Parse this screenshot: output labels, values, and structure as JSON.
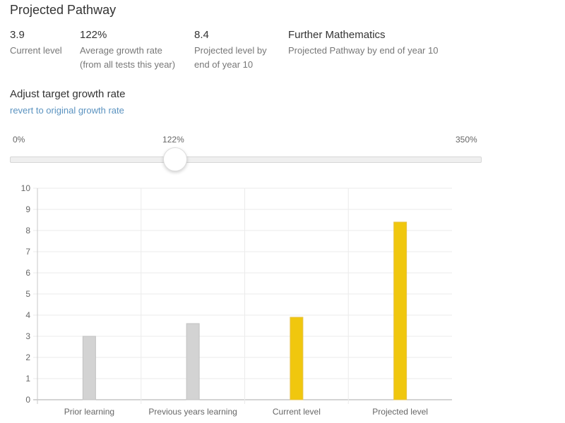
{
  "header": {
    "title": "Projected Pathway"
  },
  "stats": [
    {
      "value": "3.9",
      "label_lines": [
        "Current level"
      ]
    },
    {
      "value": "122%",
      "label_lines": [
        "Average growth rate",
        "(from all tests this year)"
      ]
    },
    {
      "value": "8.4",
      "label_lines": [
        "Projected level by",
        "end of year 10"
      ]
    },
    {
      "value": "Further Mathematics",
      "label_lines": [
        "Projected Pathway by end of year 10"
      ]
    }
  ],
  "adjust": {
    "heading": "Adjust target growth rate",
    "revert_link": "revert to original growth rate"
  },
  "slider": {
    "min_label": "0%",
    "max_label": "350%",
    "value_label": "122%",
    "min": 0,
    "max": 350,
    "value": 122
  },
  "colors": {
    "past_bar": "#d3d3d3",
    "past_bar_border": "#c2c2c2",
    "current_bar": "#f0c70e",
    "current_bar_border": "#e6c24a",
    "link": "#5b93c0"
  },
  "chart_data": {
    "type": "bar",
    "title": "",
    "xlabel": "",
    "ylabel": "",
    "categories": [
      "Prior learning",
      "Previous years learning",
      "Current level",
      "Projected level"
    ],
    "values": [
      3.0,
      3.6,
      3.9,
      8.4
    ],
    "bar_color_keys": [
      "past_bar",
      "past_bar",
      "current_bar",
      "current_bar"
    ],
    "ylim": [
      0,
      10
    ],
    "yticks": [
      0,
      1,
      2,
      3,
      4,
      5,
      6,
      7,
      8,
      9,
      10
    ],
    "grid": true,
    "legend": "none"
  }
}
